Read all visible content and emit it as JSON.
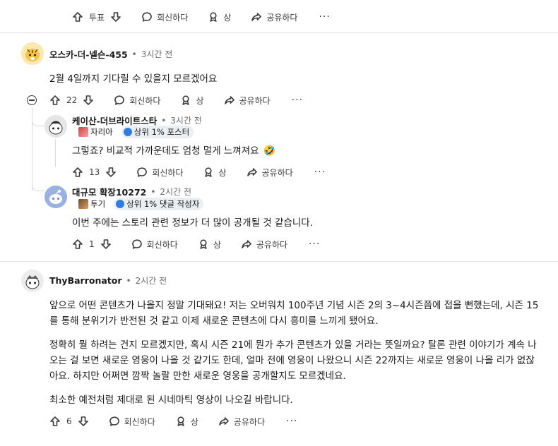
{
  "top_actions": {
    "vote_label": "투표",
    "reply": "회신하다",
    "award": "상",
    "share": "공유하다",
    "more": "···"
  },
  "comments": [
    {
      "username": "오스카-더-넬슨-455",
      "time": "3시간 전",
      "body": "2월 4일까지 기다릴 수 있을지 모르겠어요",
      "votes": "22",
      "reply": "회신하다",
      "award": "상",
      "share": "공유하다",
      "more": "···"
    },
    {
      "username": "케이산-더브라이트스타",
      "time": "3시간 전",
      "flair_user": "자리아",
      "flair_rank": "상위 1% 포스터",
      "body": "그렇죠? 비교적 가까운데도 엄청 멀게 느껴져요",
      "emoji": "🤣",
      "votes": "13",
      "reply": "회신하다",
      "award": "상",
      "share": "공유하다",
      "more": "···"
    },
    {
      "username": "대규모 확장10272",
      "time": "2시간 전",
      "flair_user": "투기",
      "flair_rank": "상위 1% 댓글 작성자",
      "body": "이번 주에는 스토리 관련 정보가 더 많이 공개될 것 같습니다.",
      "votes": "1",
      "reply": "회신하다",
      "award": "상",
      "share": "공유하다",
      "more": "···"
    },
    {
      "username": "ThyBarronator",
      "time": "2시간 전",
      "paragraphs": [
        "앞으로 어떤 콘텐츠가 나올지 정말 기대돼요! 저는 오버워치 100주년 기념 시즌 2의 3~4시즌쯤에 접을 뻔했는데, 시즌 15를 통해 분위기가 반전된 것 같고 이제 새로운 콘텐츠에 다시 흥미를 느끼게 됐어요.",
        "정확히 뭘 하려는 건지 모르겠지만, 혹시 시즌 21에 뭔가 추가 콘텐츠가 있을 거라는 뜻일까요? 탈론 관련 이야기가 계속 나오는 걸 보면 새로운 영웅이 나올 것 같기도 한데, 얼마 전에 영웅이 나왔으니 시즌 22까지는 새로운 영웅이 나올 리가 없잖아요. 하지만 어쩌면 깜짝 놀랄 만한 새로운 영웅을 공개할지도 모르겠네요.",
        "최소한 예전처럼 제대로 된 시네마틱 영상이 나오길 바랍니다."
      ],
      "votes": "6",
      "reply": "회신하다",
      "award": "상",
      "share": "공유하다",
      "more": "···"
    }
  ]
}
